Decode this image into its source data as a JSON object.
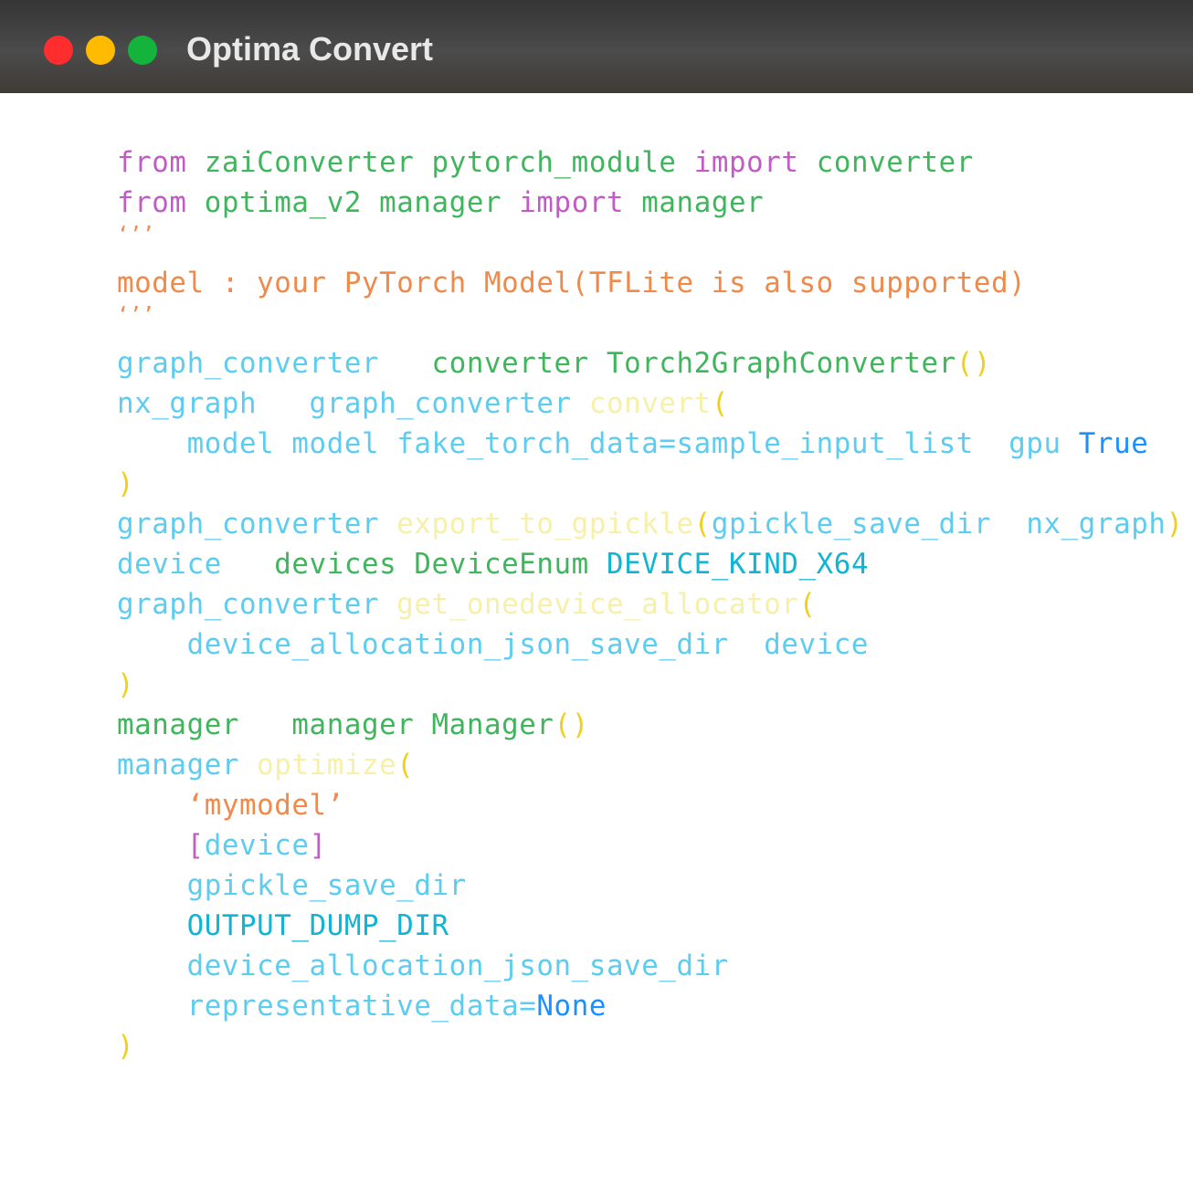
{
  "window": {
    "title": "Optima Convert",
    "controls": {
      "close_color": "#ff2d2d",
      "minimize_color": "#ffbb00",
      "zoom_color": "#14b43c"
    }
  },
  "theme": {
    "keyword": "#c25bc6",
    "module": "#3fb55c",
    "comment": "#f0894a",
    "identifier": "#5ccdf0",
    "method": "#f6f0a8",
    "paren": "#f2cf1c",
    "constant": "#11b5d3",
    "literal": "#1991ff"
  },
  "code": {
    "lines": [
      [
        {
          "text": "from",
          "kind": "keyword"
        },
        {
          "text": " zaiConverter pytorch_module ",
          "kind": "module"
        },
        {
          "text": "import",
          "kind": "keyword"
        },
        {
          "text": " converter",
          "kind": "module"
        }
      ],
      [
        {
          "text": "from",
          "kind": "keyword"
        },
        {
          "text": " optima_v2 manager ",
          "kind": "module"
        },
        {
          "text": "import",
          "kind": "keyword"
        },
        {
          "text": " manager",
          "kind": "module"
        }
      ],
      [
        {
          "text": "‘’’",
          "kind": "comment"
        }
      ],
      [
        {
          "text": "model : your PyTorch Model(TFLite is also supported)",
          "kind": "comment"
        }
      ],
      [
        {
          "text": "‘’’",
          "kind": "comment"
        }
      ],
      [
        {
          "text": "graph_converter   ",
          "kind": "identifier"
        },
        {
          "text": "converter Torch2GraphConverter",
          "kind": "module"
        },
        {
          "text": "()",
          "kind": "paren"
        }
      ],
      [
        {
          "text": "nx_graph   graph_converter ",
          "kind": "identifier"
        },
        {
          "text": "convert",
          "kind": "method"
        },
        {
          "text": "(",
          "kind": "paren"
        }
      ],
      [
        {
          "text": "    model model fake_torch_data=sample_input_list  gpu ",
          "kind": "identifier"
        },
        {
          "text": "True",
          "kind": "literal"
        }
      ],
      [
        {
          "text": ")",
          "kind": "paren"
        }
      ],
      [
        {
          "text": "graph_converter ",
          "kind": "identifier"
        },
        {
          "text": "export_to_gpickle",
          "kind": "method"
        },
        {
          "text": "(",
          "kind": "paren"
        },
        {
          "text": "gpickle_save_dir  nx_graph",
          "kind": "identifier"
        },
        {
          "text": ")",
          "kind": "paren"
        }
      ],
      [
        {
          "text": "device   ",
          "kind": "identifier"
        },
        {
          "text": "devices DeviceEnum ",
          "kind": "module"
        },
        {
          "text": "DEVICE_KIND_X64",
          "kind": "constant"
        }
      ],
      [
        {
          "text": "graph_converter ",
          "kind": "identifier"
        },
        {
          "text": "get_onedevice_allocator",
          "kind": "method"
        },
        {
          "text": "(",
          "kind": "paren"
        }
      ],
      [
        {
          "text": "    device_allocation_json_save_dir  device",
          "kind": "identifier"
        }
      ],
      [
        {
          "text": ")",
          "kind": "paren"
        }
      ],
      [
        {
          "text": "manager   manager Manager",
          "kind": "module"
        },
        {
          "text": "()",
          "kind": "paren"
        }
      ],
      [
        {
          "text": "manager ",
          "kind": "identifier"
        },
        {
          "text": "optimize",
          "kind": "method"
        },
        {
          "text": "(",
          "kind": "paren"
        }
      ],
      [
        {
          "text": "    ‘mymodel’",
          "kind": "comment"
        }
      ],
      [
        {
          "text": "    ",
          "kind": "identifier"
        },
        {
          "text": "[",
          "kind": "keyword"
        },
        {
          "text": "device",
          "kind": "identifier"
        },
        {
          "text": "]",
          "kind": "keyword"
        }
      ],
      [
        {
          "text": "    gpickle_save_dir",
          "kind": "identifier"
        }
      ],
      [
        {
          "text": "    ",
          "kind": "identifier"
        },
        {
          "text": "OUTPUT_DUMP_DIR",
          "kind": "constant"
        }
      ],
      [
        {
          "text": "    device_allocation_json_save_dir",
          "kind": "identifier"
        }
      ],
      [
        {
          "text": "    representative_data=",
          "kind": "identifier"
        },
        {
          "text": "None",
          "kind": "literal"
        }
      ],
      [
        {
          "text": ")",
          "kind": "paren"
        }
      ]
    ]
  }
}
